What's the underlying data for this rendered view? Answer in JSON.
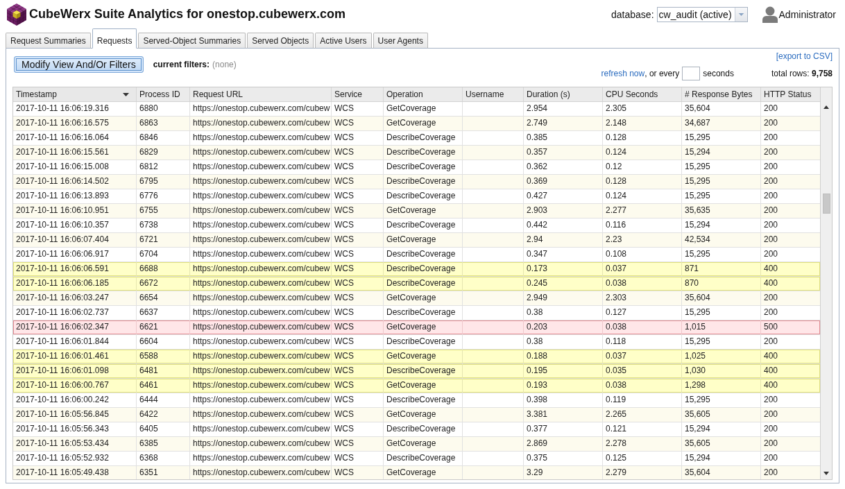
{
  "header": {
    "title": "CubeWerx Suite Analytics for onestop.cubewerx.com",
    "database": {
      "label": "database:",
      "value": "cw_audit (active)"
    },
    "user": {
      "name": "Administrator"
    }
  },
  "tabs": [
    {
      "label": "Request Summaries",
      "selected": false
    },
    {
      "label": "Requests",
      "selected": true
    },
    {
      "label": "Served-Object Summaries",
      "selected": false
    },
    {
      "label": "Served Objects",
      "selected": false
    },
    {
      "label": "Active Users",
      "selected": false
    },
    {
      "label": "User Agents",
      "selected": false
    }
  ],
  "toolbar": {
    "modify_button": "Modify View And/Or Filters",
    "current_filters": {
      "label": "current filters:",
      "value": "(none)"
    },
    "export_link": "[export to CSV]",
    "refresh": {
      "link": "refresh now",
      "interval_label": ", or every",
      "unit": "seconds"
    },
    "total_rows": "total rows: **9,758**"
  },
  "table": {
    "columns": [
      {
        "label": "Timestamp",
        "sorted": true
      },
      {
        "label": "Process ID",
        "sorted": false
      },
      {
        "label": "Request URL",
        "sorted": false
      },
      {
        "label": "Service",
        "sorted": false
      },
      {
        "label": "Operation",
        "sorted": false
      },
      {
        "label": "Username",
        "sorted": false
      },
      {
        "label": "Duration (s)",
        "sorted": false
      },
      {
        "label": "CPU Seconds",
        "sorted": false
      },
      {
        "label": "# Response Bytes",
        "sorted": false
      },
      {
        "label": "HTTP Status",
        "sorted": false
      }
    ],
    "rows": [
      {
        "timestamp": "2017-10-11 16:06:19.316",
        "process_id": "6880",
        "request_url": "https://onestop.cubewerx.com/cubew",
        "service": "WCS",
        "operation": "GetCoverage",
        "duration": "2.954",
        "cpu_seconds": "2.305",
        "response_bytes": "35,604",
        "http_status": "200",
        "kind": "ok"
      },
      {
        "timestamp": "2017-10-11 16:06:16.575",
        "process_id": "6863",
        "request_url": "https://onestop.cubewerx.com/cubew",
        "service": "WCS",
        "operation": "GetCoverage",
        "duration": "2.749",
        "cpu_seconds": "2.148",
        "response_bytes": "34,687",
        "http_status": "200",
        "kind": "ok"
      },
      {
        "timestamp": "2017-10-11 16:06:16.064",
        "process_id": "6846",
        "request_url": "https://onestop.cubewerx.com/cubew",
        "service": "WCS",
        "operation": "DescribeCoverage",
        "duration": "0.385",
        "cpu_seconds": "0.128",
        "response_bytes": "15,295",
        "http_status": "200",
        "kind": "ok"
      },
      {
        "timestamp": "2017-10-11 16:06:15.561",
        "process_id": "6829",
        "request_url": "https://onestop.cubewerx.com/cubew",
        "service": "WCS",
        "operation": "DescribeCoverage",
        "duration": "0.357",
        "cpu_seconds": "0.124",
        "response_bytes": "15,294",
        "http_status": "200",
        "kind": "ok"
      },
      {
        "timestamp": "2017-10-11 16:06:15.008",
        "process_id": "6812",
        "request_url": "https://onestop.cubewerx.com/cubew",
        "service": "WCS",
        "operation": "DescribeCoverage",
        "duration": "0.362",
        "cpu_seconds": "0.12",
        "response_bytes": "15,295",
        "http_status": "200",
        "kind": "ok"
      },
      {
        "timestamp": "2017-10-11 16:06:14.502",
        "process_id": "6795",
        "request_url": "https://onestop.cubewerx.com/cubew",
        "service": "WCS",
        "operation": "DescribeCoverage",
        "duration": "0.369",
        "cpu_seconds": "0.128",
        "response_bytes": "15,295",
        "http_status": "200",
        "kind": "ok"
      },
      {
        "timestamp": "2017-10-11 16:06:13.893",
        "process_id": "6776",
        "request_url": "https://onestop.cubewerx.com/cubew",
        "service": "WCS",
        "operation": "DescribeCoverage",
        "duration": "0.427",
        "cpu_seconds": "0.124",
        "response_bytes": "15,295",
        "http_status": "200",
        "kind": "ok"
      },
      {
        "timestamp": "2017-10-11 16:06:10.951",
        "process_id": "6755",
        "request_url": "https://onestop.cubewerx.com/cubew",
        "service": "WCS",
        "operation": "GetCoverage",
        "duration": "2.903",
        "cpu_seconds": "2.277",
        "response_bytes": "35,635",
        "http_status": "200",
        "kind": "ok"
      },
      {
        "timestamp": "2017-10-11 16:06:10.357",
        "process_id": "6738",
        "request_url": "https://onestop.cubewerx.com/cubew",
        "service": "WCS",
        "operation": "DescribeCoverage",
        "duration": "0.442",
        "cpu_seconds": "0.116",
        "response_bytes": "15,294",
        "http_status": "200",
        "kind": "ok"
      },
      {
        "timestamp": "2017-10-11 16:06:07.404",
        "process_id": "6721",
        "request_url": "https://onestop.cubewerx.com/cubew",
        "service": "WCS",
        "operation": "GetCoverage",
        "duration": "2.94",
        "cpu_seconds": "2.23",
        "response_bytes": "42,534",
        "http_status": "200",
        "kind": "ok"
      },
      {
        "timestamp": "2017-10-11 16:06:06.917",
        "process_id": "6704",
        "request_url": "https://onestop.cubewerx.com/cubew",
        "service": "WCS",
        "operation": "DescribeCoverage",
        "duration": "0.347",
        "cpu_seconds": "0.108",
        "response_bytes": "15,295",
        "http_status": "200",
        "kind": "ok"
      },
      {
        "timestamp": "2017-10-11 16:06:06.591",
        "process_id": "6688",
        "request_url": "https://onestop.cubewerx.com/cubew",
        "service": "WCS",
        "operation": "DescribeCoverage",
        "duration": "0.173",
        "cpu_seconds": "0.037",
        "response_bytes": "871",
        "http_status": "400",
        "kind": "client_error"
      },
      {
        "timestamp": "2017-10-11 16:06:06.185",
        "process_id": "6672",
        "request_url": "https://onestop.cubewerx.com/cubew",
        "service": "WCS",
        "operation": "DescribeCoverage",
        "duration": "0.245",
        "cpu_seconds": "0.038",
        "response_bytes": "870",
        "http_status": "400",
        "kind": "client_error"
      },
      {
        "timestamp": "2017-10-11 16:06:03.247",
        "process_id": "6654",
        "request_url": "https://onestop.cubewerx.com/cubew",
        "service": "WCS",
        "operation": "GetCoverage",
        "duration": "2.949",
        "cpu_seconds": "2.303",
        "response_bytes": "35,604",
        "http_status": "200",
        "kind": "ok"
      },
      {
        "timestamp": "2017-10-11 16:06:02.737",
        "process_id": "6637",
        "request_url": "https://onestop.cubewerx.com/cubew",
        "service": "WCS",
        "operation": "DescribeCoverage",
        "duration": "0.38",
        "cpu_seconds": "0.127",
        "response_bytes": "15,295",
        "http_status": "200",
        "kind": "ok"
      },
      {
        "timestamp": "2017-10-11 16:06:02.347",
        "process_id": "6621",
        "request_url": "https://onestop.cubewerx.com/cubew",
        "service": "WCS",
        "operation": "GetCoverage",
        "duration": "0.203",
        "cpu_seconds": "0.038",
        "response_bytes": "1,015",
        "http_status": "500",
        "kind": "server_error"
      },
      {
        "timestamp": "2017-10-11 16:06:01.844",
        "process_id": "6604",
        "request_url": "https://onestop.cubewerx.com/cubew",
        "service": "WCS",
        "operation": "DescribeCoverage",
        "duration": "0.38",
        "cpu_seconds": "0.118",
        "response_bytes": "15,295",
        "http_status": "200",
        "kind": "ok"
      },
      {
        "timestamp": "2017-10-11 16:06:01.461",
        "process_id": "6588",
        "request_url": "https://onestop.cubewerx.com/cubew",
        "service": "WCS",
        "operation": "GetCoverage",
        "duration": "0.188",
        "cpu_seconds": "0.037",
        "response_bytes": "1,025",
        "http_status": "400",
        "kind": "client_error"
      },
      {
        "timestamp": "2017-10-11 16:06:01.098",
        "process_id": "6481",
        "request_url": "https://onestop.cubewerx.com/cubew",
        "service": "WCS",
        "operation": "DescribeCoverage",
        "duration": "0.195",
        "cpu_seconds": "0.035",
        "response_bytes": "1,030",
        "http_status": "400",
        "kind": "client_error"
      },
      {
        "timestamp": "2017-10-11 16:06:00.767",
        "process_id": "6461",
        "request_url": "https://onestop.cubewerx.com/cubew",
        "service": "WCS",
        "operation": "GetCoverage",
        "duration": "0.193",
        "cpu_seconds": "0.038",
        "response_bytes": "1,298",
        "http_status": "400",
        "kind": "client_error"
      },
      {
        "timestamp": "2017-10-11 16:06:00.242",
        "process_id": "6444",
        "request_url": "https://onestop.cubewerx.com/cubew",
        "service": "WCS",
        "operation": "DescribeCoverage",
        "duration": "0.398",
        "cpu_seconds": "0.119",
        "response_bytes": "15,295",
        "http_status": "200",
        "kind": "ok"
      },
      {
        "timestamp": "2017-10-11 16:05:56.845",
        "process_id": "6422",
        "request_url": "https://onestop.cubewerx.com/cubew",
        "service": "WCS",
        "operation": "GetCoverage",
        "duration": "3.381",
        "cpu_seconds": "2.265",
        "response_bytes": "35,605",
        "http_status": "200",
        "kind": "ok"
      },
      {
        "timestamp": "2017-10-11 16:05:56.343",
        "process_id": "6405",
        "request_url": "https://onestop.cubewerx.com/cubew",
        "service": "WCS",
        "operation": "DescribeCoverage",
        "duration": "0.377",
        "cpu_seconds": "0.121",
        "response_bytes": "15,294",
        "http_status": "200",
        "kind": "ok"
      },
      {
        "timestamp": "2017-10-11 16:05:53.434",
        "process_id": "6385",
        "request_url": "https://onestop.cubewerx.com/cubew",
        "service": "WCS",
        "operation": "GetCoverage",
        "duration": "2.869",
        "cpu_seconds": "2.278",
        "response_bytes": "35,605",
        "http_status": "200",
        "kind": "ok"
      },
      {
        "timestamp": "2017-10-11 16:05:52.932",
        "process_id": "6368",
        "request_url": "https://onestop.cubewerx.com/cubew",
        "service": "WCS",
        "operation": "DescribeCoverage",
        "duration": "0.375",
        "cpu_seconds": "0.125",
        "response_bytes": "15,294",
        "http_status": "200",
        "kind": "ok"
      },
      {
        "timestamp": "2017-10-11 16:05:49.438",
        "process_id": "6351",
        "request_url": "https://onestop.cubewerx.com/cubew",
        "service": "WCS",
        "operation": "GetCoverage",
        "duration": "3.29",
        "cpu_seconds": "2.279",
        "response_bytes": "35,604",
        "http_status": "200",
        "kind": "ok"
      }
    ]
  }
}
